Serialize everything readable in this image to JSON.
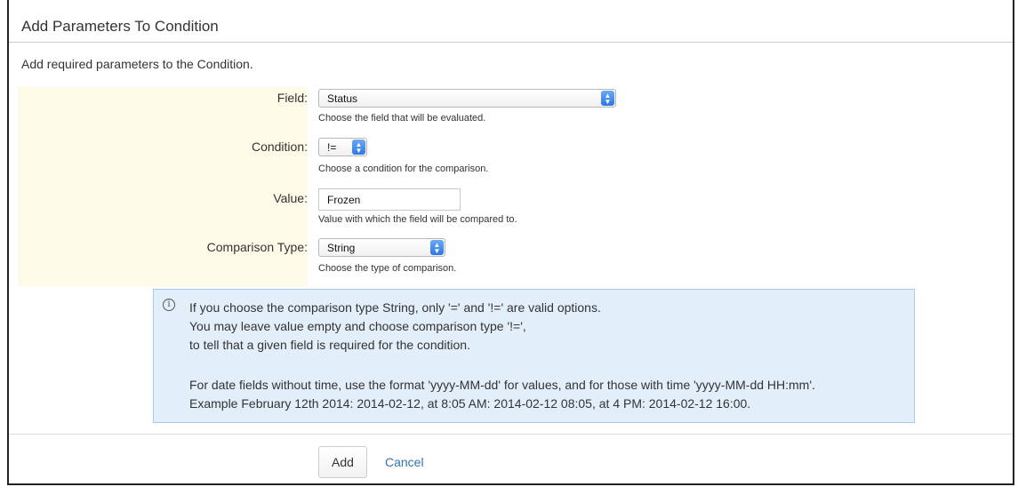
{
  "dialog": {
    "title": "Add Parameters To Condition",
    "intro": "Add required parameters to the Condition."
  },
  "form": {
    "field": {
      "label": "Field:",
      "value": "Status",
      "description": "Choose the field that will be evaluated."
    },
    "condition": {
      "label": "Condition:",
      "value": "!=",
      "description": "Choose a condition for the comparison."
    },
    "value": {
      "label": "Value:",
      "value": "Frozen",
      "description": "Value with which the field will be compared to."
    },
    "comparison_type": {
      "label": "Comparison Type:",
      "value": "String",
      "description": "Choose the type of comparison."
    }
  },
  "info": {
    "icon": "info-icon",
    "lines": [
      "If you choose the comparison type String, only '=' and '!=' are valid options.",
      "You may leave value empty and choose comparison type '!=',",
      "to tell that a given field is required for the condition.",
      "For date fields without time, use the format 'yyyy-MM-dd' for values, and for those with time 'yyyy-MM-dd HH:mm'.",
      "Example February 12th 2014: 2014-02-12, at 8:05 AM: 2014-02-12 08:05, at 4 PM: 2014-02-12 16:00."
    ]
  },
  "actions": {
    "add_label": "Add",
    "cancel_label": "Cancel"
  },
  "colors": {
    "accent": "#3572b0",
    "highlight": "#fdfbe8",
    "info_bg": "#e3eefb"
  }
}
